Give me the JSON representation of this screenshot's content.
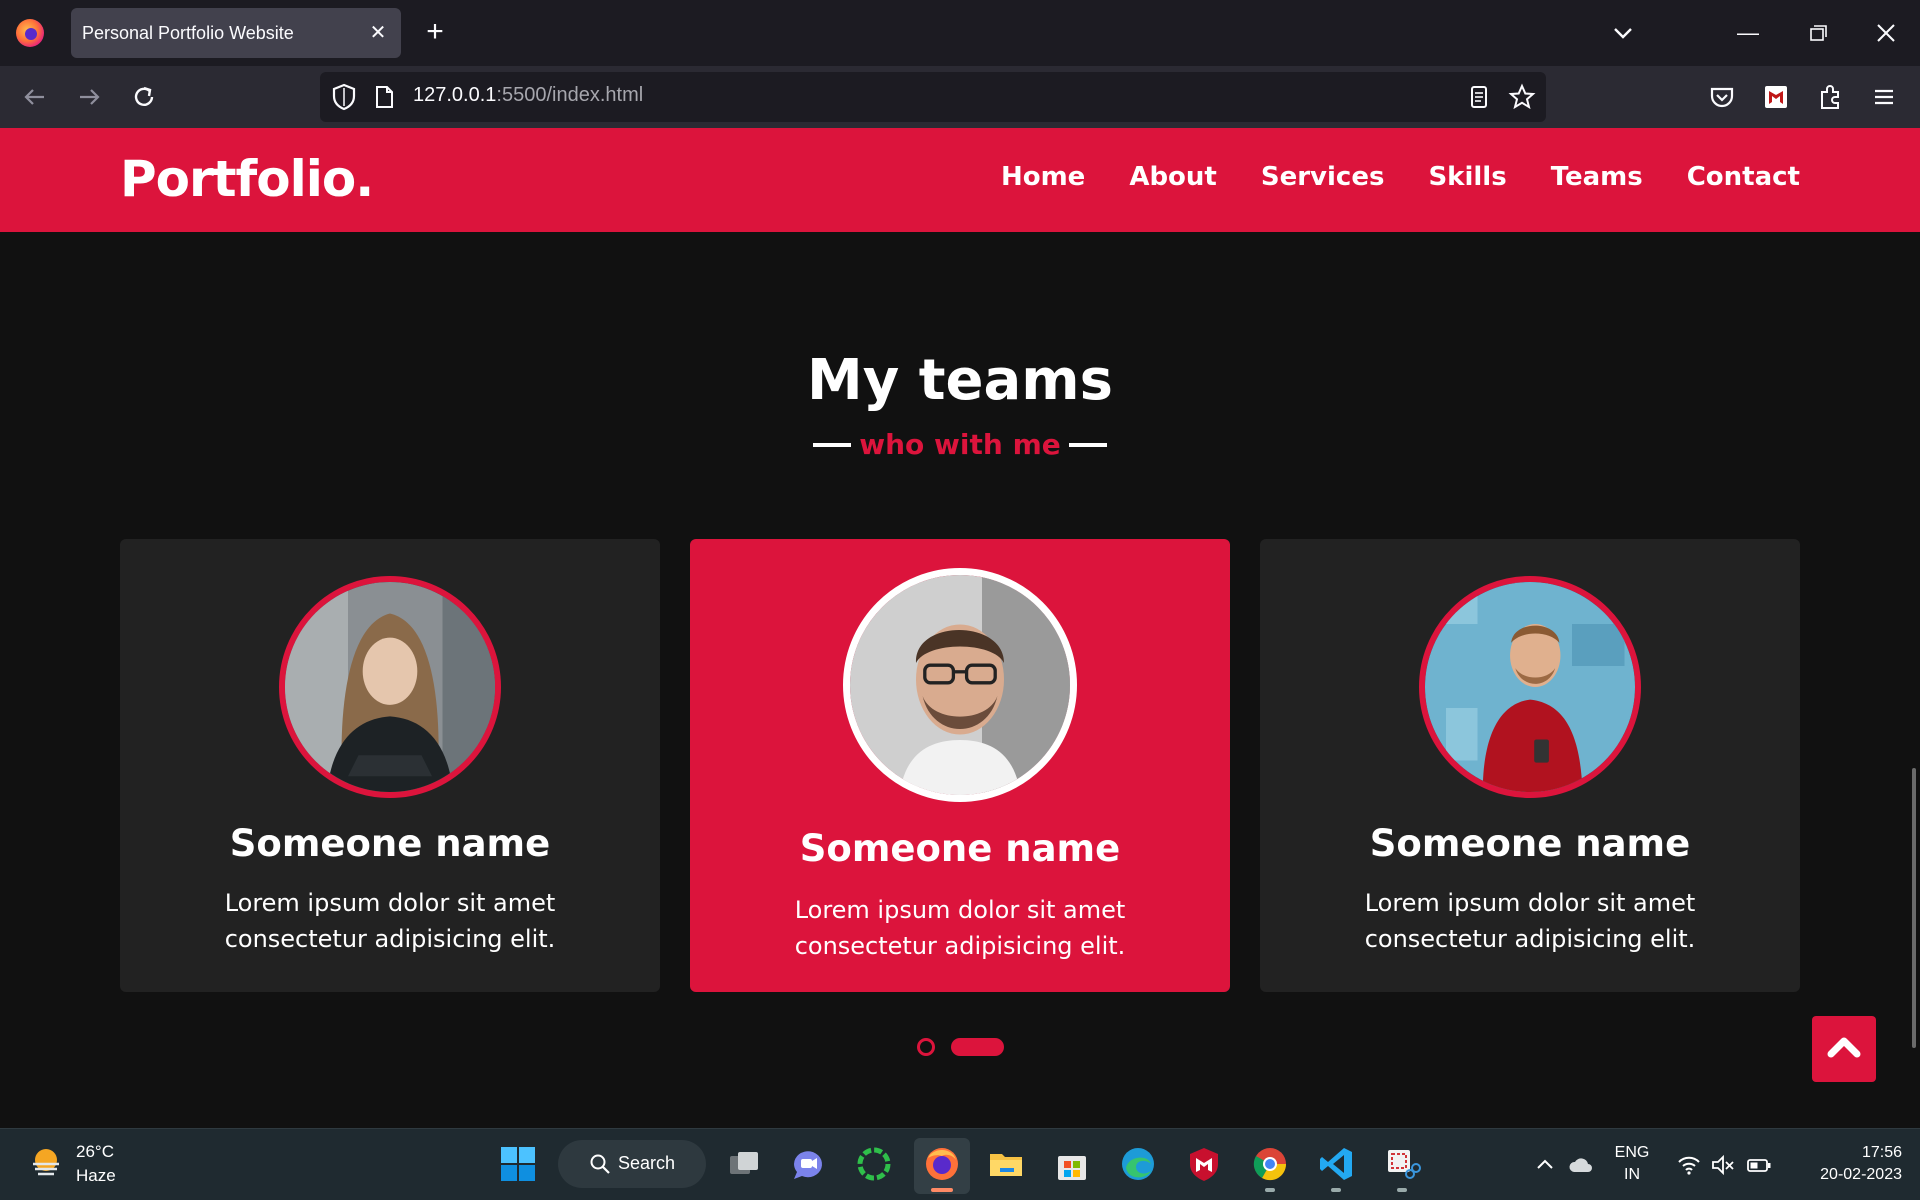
{
  "browser": {
    "tab_title": "Personal Portfolio Website",
    "url_host": "127.0.0.1",
    "url_rest": ":5500/index.html"
  },
  "site": {
    "logo": "Portfolio.",
    "nav": [
      "Home",
      "About",
      "Services",
      "Skills",
      "Teams",
      "Contact"
    ],
    "section_title": "My teams",
    "section_subtitle": "who with me",
    "cards": [
      {
        "name": "Someone name",
        "desc": "Lorem ipsum dolor sit amet consectetur adipisicing elit."
      },
      {
        "name": "Someone name",
        "desc": "Lorem ipsum dolor sit amet consectetur adipisicing elit."
      },
      {
        "name": "Someone name",
        "desc": "Lorem ipsum dolor sit amet consectetur adipisicing elit."
      }
    ],
    "accent_color": "#dc143c"
  },
  "taskbar": {
    "weather_temp": "26°C",
    "weather_cond": "Haze",
    "search_label": "Search",
    "lang_line1": "ENG",
    "lang_line2": "IN",
    "time": "17:56",
    "date": "20-02-2023"
  }
}
